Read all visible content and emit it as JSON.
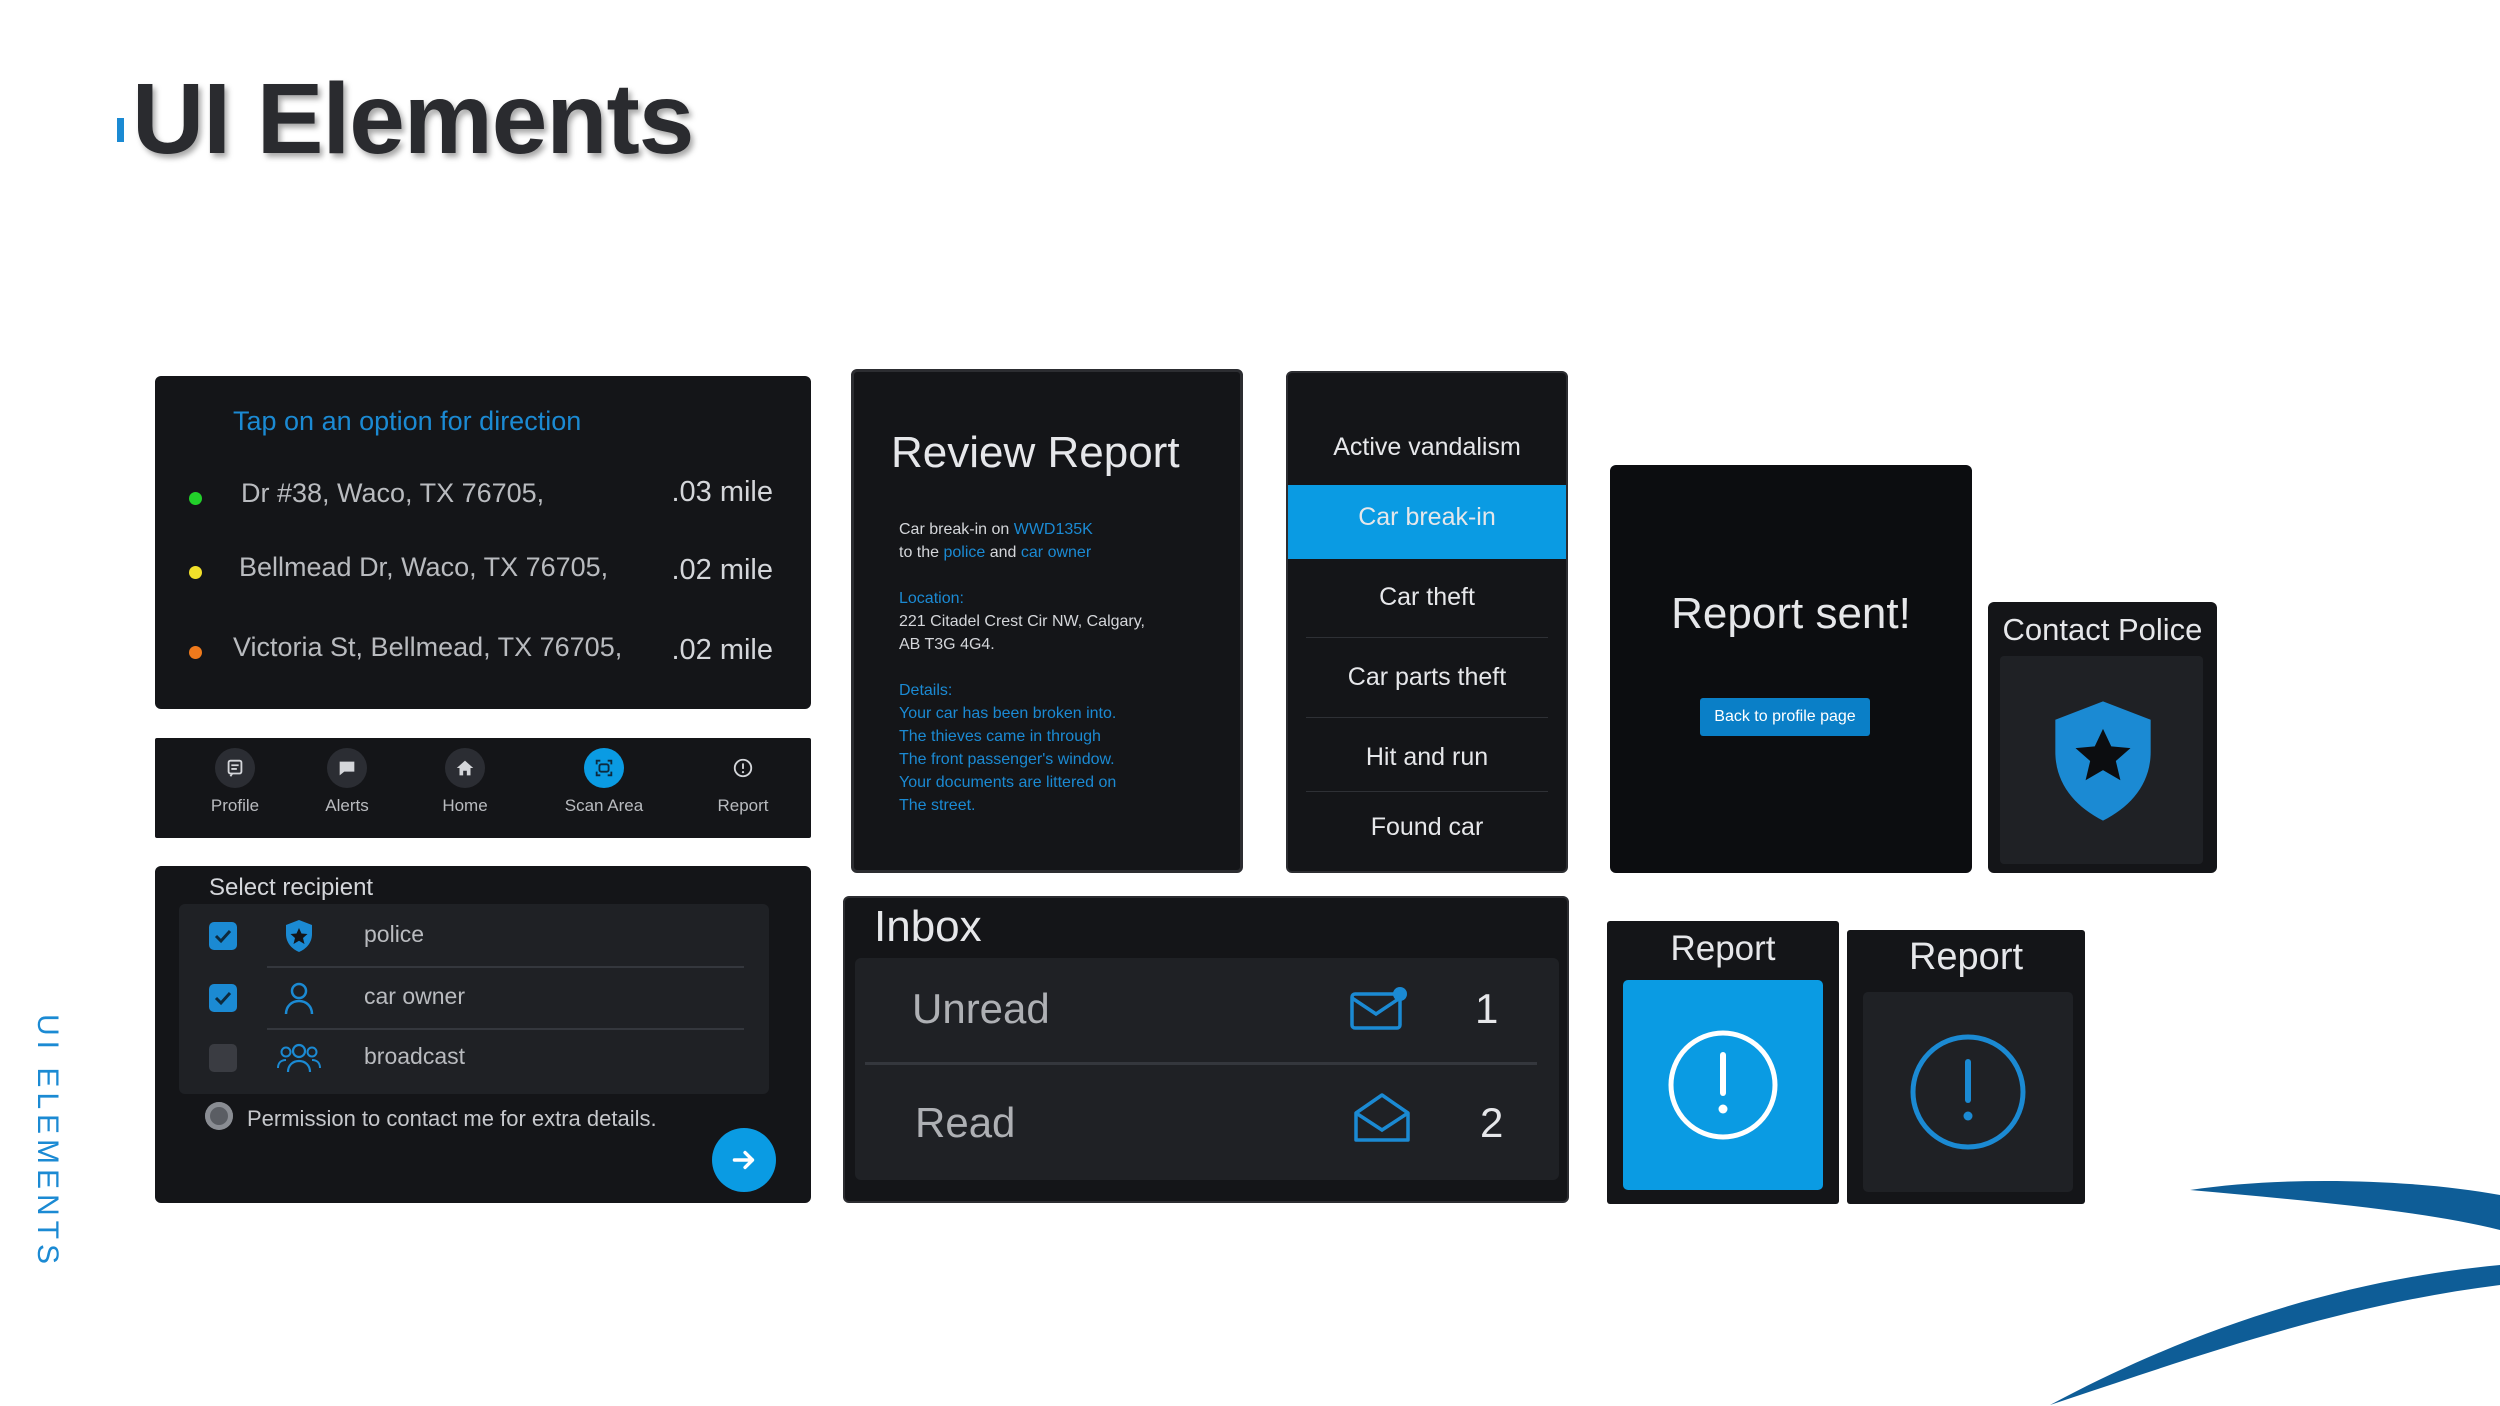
{
  "page": {
    "title": "UI Elements",
    "side_label": "UI ELEMENTS"
  },
  "directions": {
    "header": "Tap on an option for direction",
    "items": [
      {
        "address": "Dr #38, Waco, TX 76705,",
        "distance": ".03 mile",
        "dot_color": "#22d02a"
      },
      {
        "address": "Bellmead Dr, Waco, TX 76705,",
        "distance": ".02 mile",
        "dot_color": "#f2e02a"
      },
      {
        "address": "Victoria St, Bellmead, TX 76705,",
        "distance": ".02 mile",
        "dot_color": "#f07a1c"
      }
    ]
  },
  "nav": {
    "items": [
      {
        "label": "Profile",
        "icon": "profile-icon"
      },
      {
        "label": "Alerts",
        "icon": "chat-icon"
      },
      {
        "label": "Home",
        "icon": "home-icon"
      },
      {
        "label": "Scan Area",
        "icon": "scan-icon",
        "active": true
      },
      {
        "label": "Report",
        "icon": "alert-circle-icon"
      }
    ]
  },
  "recipient": {
    "header": "Select recipient",
    "items": [
      {
        "label": "police",
        "checked": true,
        "icon": "shield-star-icon"
      },
      {
        "label": "car owner",
        "checked": true,
        "icon": "person-icon"
      },
      {
        "label": "broadcast",
        "checked": false,
        "icon": "group-icon"
      }
    ],
    "permission": "Permission to contact me for extra details."
  },
  "review": {
    "title": "Review Report",
    "line1_a": "Car break-in  on ",
    "line1_plate": "WWD135K",
    "line2_a": "to the ",
    "line2_police": "police",
    "line2_and": " and ",
    "line2_owner": "car owner",
    "location_label": "Location:",
    "location_line1": "221 Citadel Crest Cir NW, Calgary,",
    "location_line2": "AB T3G 4G4.",
    "details_label": "Details:",
    "details_lines": [
      "Your car has been broken into.",
      "The thieves came in through",
      "The front passenger's window.",
      "Your documents are littered on",
      "The street."
    ]
  },
  "vandalism": {
    "header": "Active  vandalism",
    "items": [
      "Car break-in",
      "Car theft",
      "Car parts theft",
      "Hit and run",
      "Found car"
    ],
    "selected_index": 0
  },
  "inbox": {
    "title": "Inbox",
    "rows": [
      {
        "label": "Unread",
        "count": "1",
        "icon": "mail-unread-icon"
      },
      {
        "label": "Read",
        "count": "2",
        "icon": "mail-open-icon"
      }
    ]
  },
  "report_sent": {
    "title": "Report sent!",
    "button": "Back to profile page"
  },
  "contact_police": {
    "title": "Contact Police"
  },
  "report_active": {
    "title": "Report"
  },
  "report_idle": {
    "title": "Report"
  },
  "colors": {
    "accent": "#1b8ad3",
    "active_fill": "#0a9be3",
    "panel_bg": "#141518",
    "card_bg": "#1f2125"
  }
}
